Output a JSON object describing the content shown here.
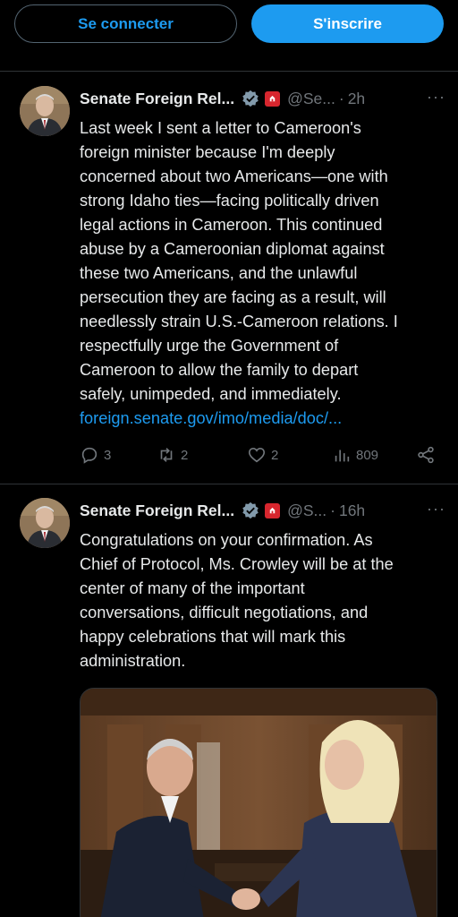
{
  "auth": {
    "login_label": "Se connecter",
    "signup_label": "S'inscrire"
  },
  "tweets": [
    {
      "name": "Senate Foreign Rel...",
      "handle": "@Se...",
      "sep": "·",
      "time": "2h",
      "more": "···",
      "lines": [
        "Last week I sent a letter to Cameroon's",
        "foreign minister because I'm deeply",
        "concerned about two Americans—one with",
        "strong Idaho ties—facing politically driven",
        "legal actions in Cameroon. This continued",
        "abuse by a Cameroonian diplomat against",
        "these two Americans, and the unlawful",
        "persecution they are facing as a result, will",
        "needlessly strain U.S.-Cameroon relations. I",
        "respectfully urge the Government of",
        "Cameroon to allow the family to depart",
        "safely, unimpeded, and immediately."
      ],
      "link": "foreign.senate.gov/imo/media/doc/...",
      "replies": "3",
      "reposts": "2",
      "likes": "2",
      "views": "809"
    },
    {
      "name": "Senate Foreign Rel...",
      "handle": "@S...",
      "sep": "·",
      "time": "16h",
      "more": "···",
      "lines": [
        "Congratulations on your confirmation. As",
        "Chief of Protocol, Ms. Crowley will be at the",
        "center of many of the important",
        "conversations, difficult negotiations, and",
        "happy celebrations that will mark this",
        "administration."
      ]
    }
  ],
  "colors": {
    "accent": "#1d9bf0",
    "muted": "#71767b",
    "border": "#2f3336",
    "affiliate_badge": "#d7262e"
  },
  "icons": [
    "verified-badge-icon",
    "affiliate-badge-icon",
    "reply-icon",
    "repost-icon",
    "like-icon",
    "views-icon",
    "share-icon"
  ]
}
